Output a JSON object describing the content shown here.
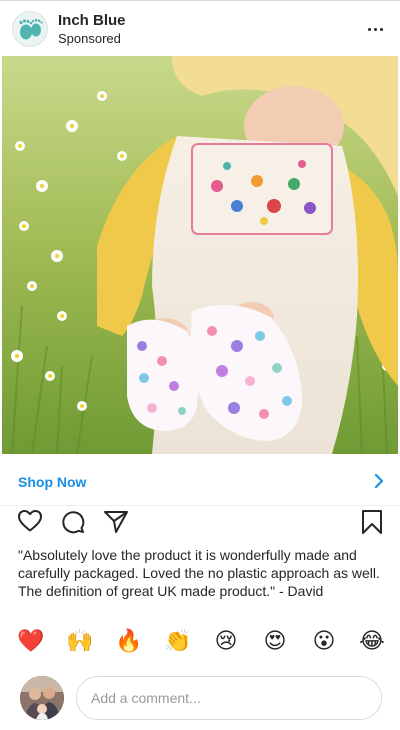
{
  "header": {
    "account_name": "Inch Blue",
    "sponsored_label": "Sponsored"
  },
  "cta": {
    "label": "Shop Now"
  },
  "caption": {
    "text": "\"Absolutely love the product it is wonderfully made and carefully packaged. Loved the no plastic approach as well. The definition of great UK made product.\" - David"
  },
  "reactions": [
    "❤️",
    "🙌",
    "🔥",
    "👏",
    "😢",
    "😍",
    "😮",
    "😂"
  ],
  "comment": {
    "placeholder": "Add a comment..."
  },
  "colors": {
    "link_blue": "#1a8fe3",
    "text": "#262626",
    "brand_teal": "#4fb3b0"
  }
}
